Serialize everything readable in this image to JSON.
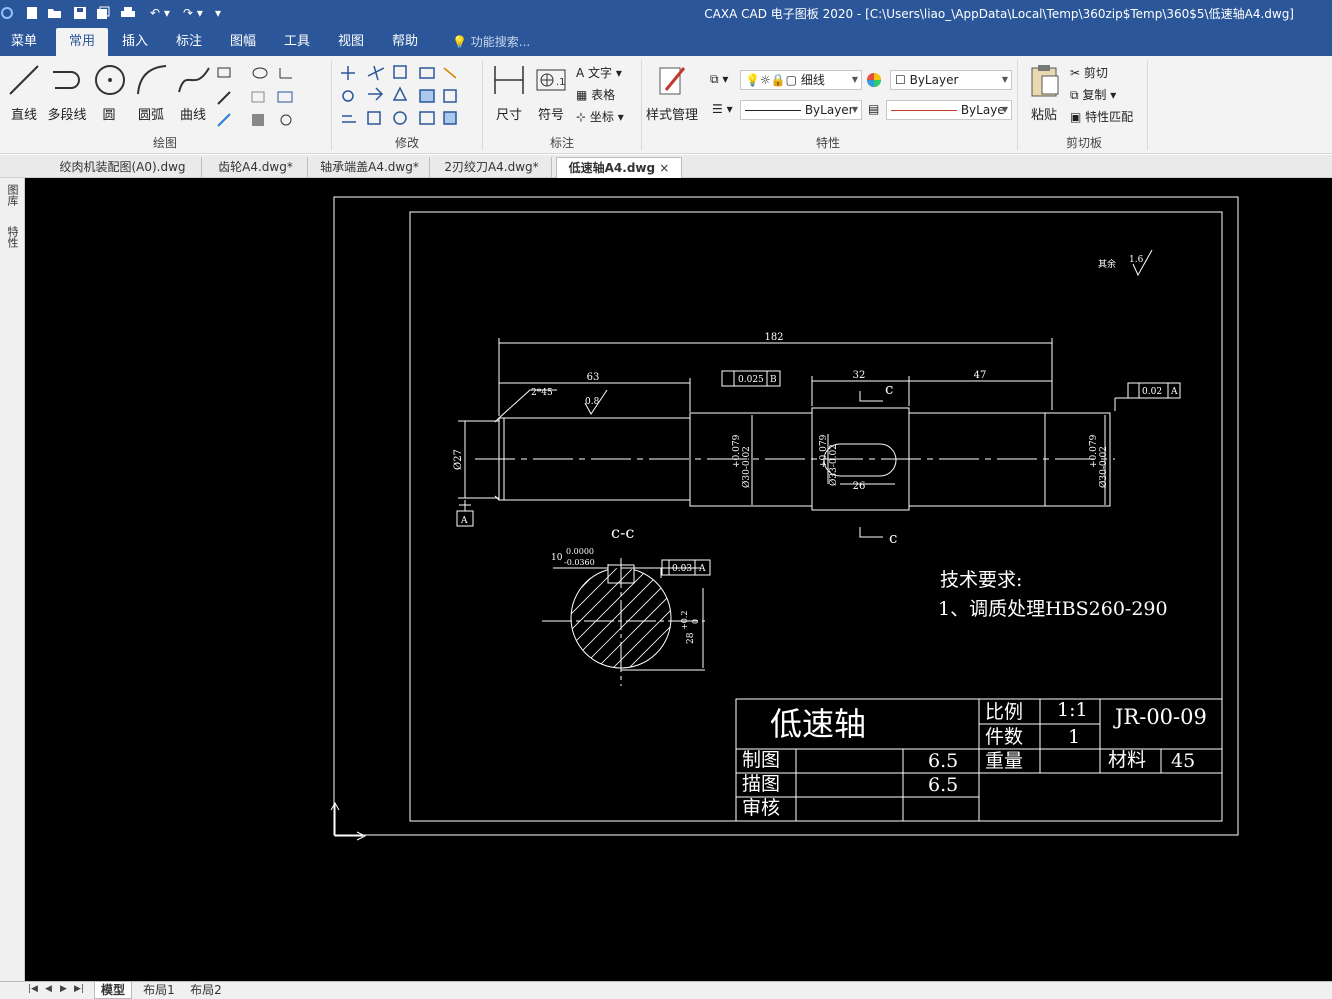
{
  "app": {
    "title": "CAXA CAD 电子图板 2020 - [C:\\Users\\liao_\\AppData\\Local\\Temp\\360zip$Temp\\360$5\\低速轴A4.dwg]"
  },
  "menu": {
    "items": [
      "菜单",
      "常用",
      "插入",
      "标注",
      "图幅",
      "工具",
      "视图",
      "帮助"
    ],
    "active": "常用",
    "search_placeholder": "功能搜索..."
  },
  "ribbon": {
    "draw": {
      "label": "绘图",
      "buttons": [
        "直线",
        "多段线",
        "圆",
        "圆弧",
        "曲线"
      ]
    },
    "modify": {
      "label": "修改"
    },
    "annotate": {
      "label": "标注",
      "buttons": [
        "尺寸",
        "符号"
      ],
      "small": [
        "文字",
        "表格",
        "坐标"
      ]
    },
    "props": {
      "label": "特性",
      "style_btn": "样式管理",
      "layer_name": "细线",
      "color": "ByLayer",
      "linetype": "ByLayer",
      "lineweight": "ByLaye"
    },
    "clipboard": {
      "label": "剪切板",
      "paste": "粘贴",
      "cut": "剪切",
      "copy": "复制",
      "match": "特性匹配"
    }
  },
  "doc_tabs": [
    "绞肉机装配图(A0).dwg",
    "齿轮A4.dwg*",
    "轴承端盖A4.dwg*",
    "2刃绞刀A4.dwg*",
    "低速轴A4.dwg"
  ],
  "active_doc": "低速轴A4.dwg",
  "side_panel": [
    "图库",
    "特性"
  ],
  "drawing": {
    "roughness_other": "其余",
    "roughness_other_value": "1.6",
    "dims": {
      "total": "182",
      "left": "63",
      "key_len": "32",
      "right": "47",
      "key_w": "26",
      "chamfer": "2*45",
      "roughness": "0.8",
      "dia_left": "Ø27",
      "dia_mid1": "Ø30-0.02",
      "dia_mid1_tol": "+0.079",
      "dia_mid2": "Ø33-0.02",
      "dia_mid2_tol": "+0.079",
      "dia_right": "Ø30-0.02",
      "dia_right_tol": "+0.079",
      "datum_A": "A",
      "datum_B": "B"
    },
    "tol_frames": {
      "runout": [
        "0.025",
        "B"
      ],
      "right": [
        "0.02",
        "A"
      ],
      "section": [
        "0.03",
        "A"
      ]
    },
    "section_letter": "c",
    "section_title": "c-c",
    "section_dims": {
      "key_width": "10",
      "key_upper": "0.0000",
      "key_lower": "-0.0360",
      "depth": "28",
      "depth_tol_up": "+0.2",
      "depth_tol_low": "0"
    },
    "tech_req_title": "技术要求:",
    "tech_req_1": "1、调质处理HBS260-290"
  },
  "title_block": {
    "part_name": "低速轴",
    "scale_label": "比例",
    "scale": "1:1",
    "qty_label": "件数",
    "qty": "1",
    "drawing_no": "JR-00-09",
    "weight_label": "重量",
    "material_label": "材料",
    "material": "45",
    "drawn_label": "制图",
    "drawn_val": "6.5",
    "traced_label": "描图",
    "traced_val": "6.5",
    "checked_label": "审核"
  },
  "layout_tabs": [
    "模型",
    "布局1",
    "布局2"
  ],
  "active_layout": "模型"
}
